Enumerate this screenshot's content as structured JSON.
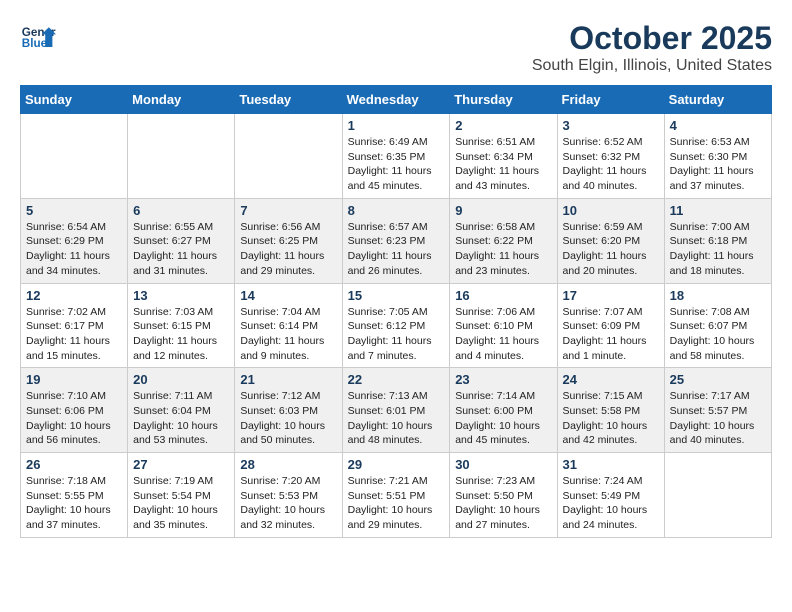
{
  "header": {
    "logo_line1": "General",
    "logo_line2": "Blue",
    "title": "October 2025",
    "subtitle": "South Elgin, Illinois, United States"
  },
  "calendar": {
    "days_of_week": [
      "Sunday",
      "Monday",
      "Tuesday",
      "Wednesday",
      "Thursday",
      "Friday",
      "Saturday"
    ],
    "weeks": [
      [
        {
          "day": "",
          "info": ""
        },
        {
          "day": "",
          "info": ""
        },
        {
          "day": "",
          "info": ""
        },
        {
          "day": "1",
          "info": "Sunrise: 6:49 AM\nSunset: 6:35 PM\nDaylight: 11 hours and 45 minutes."
        },
        {
          "day": "2",
          "info": "Sunrise: 6:51 AM\nSunset: 6:34 PM\nDaylight: 11 hours and 43 minutes."
        },
        {
          "day": "3",
          "info": "Sunrise: 6:52 AM\nSunset: 6:32 PM\nDaylight: 11 hours and 40 minutes."
        },
        {
          "day": "4",
          "info": "Sunrise: 6:53 AM\nSunset: 6:30 PM\nDaylight: 11 hours and 37 minutes."
        }
      ],
      [
        {
          "day": "5",
          "info": "Sunrise: 6:54 AM\nSunset: 6:29 PM\nDaylight: 11 hours and 34 minutes."
        },
        {
          "day": "6",
          "info": "Sunrise: 6:55 AM\nSunset: 6:27 PM\nDaylight: 11 hours and 31 minutes."
        },
        {
          "day": "7",
          "info": "Sunrise: 6:56 AM\nSunset: 6:25 PM\nDaylight: 11 hours and 29 minutes."
        },
        {
          "day": "8",
          "info": "Sunrise: 6:57 AM\nSunset: 6:23 PM\nDaylight: 11 hours and 26 minutes."
        },
        {
          "day": "9",
          "info": "Sunrise: 6:58 AM\nSunset: 6:22 PM\nDaylight: 11 hours and 23 minutes."
        },
        {
          "day": "10",
          "info": "Sunrise: 6:59 AM\nSunset: 6:20 PM\nDaylight: 11 hours and 20 minutes."
        },
        {
          "day": "11",
          "info": "Sunrise: 7:00 AM\nSunset: 6:18 PM\nDaylight: 11 hours and 18 minutes."
        }
      ],
      [
        {
          "day": "12",
          "info": "Sunrise: 7:02 AM\nSunset: 6:17 PM\nDaylight: 11 hours and 15 minutes."
        },
        {
          "day": "13",
          "info": "Sunrise: 7:03 AM\nSunset: 6:15 PM\nDaylight: 11 hours and 12 minutes."
        },
        {
          "day": "14",
          "info": "Sunrise: 7:04 AM\nSunset: 6:14 PM\nDaylight: 11 hours and 9 minutes."
        },
        {
          "day": "15",
          "info": "Sunrise: 7:05 AM\nSunset: 6:12 PM\nDaylight: 11 hours and 7 minutes."
        },
        {
          "day": "16",
          "info": "Sunrise: 7:06 AM\nSunset: 6:10 PM\nDaylight: 11 hours and 4 minutes."
        },
        {
          "day": "17",
          "info": "Sunrise: 7:07 AM\nSunset: 6:09 PM\nDaylight: 11 hours and 1 minute."
        },
        {
          "day": "18",
          "info": "Sunrise: 7:08 AM\nSunset: 6:07 PM\nDaylight: 10 hours and 58 minutes."
        }
      ],
      [
        {
          "day": "19",
          "info": "Sunrise: 7:10 AM\nSunset: 6:06 PM\nDaylight: 10 hours and 56 minutes."
        },
        {
          "day": "20",
          "info": "Sunrise: 7:11 AM\nSunset: 6:04 PM\nDaylight: 10 hours and 53 minutes."
        },
        {
          "day": "21",
          "info": "Sunrise: 7:12 AM\nSunset: 6:03 PM\nDaylight: 10 hours and 50 minutes."
        },
        {
          "day": "22",
          "info": "Sunrise: 7:13 AM\nSunset: 6:01 PM\nDaylight: 10 hours and 48 minutes."
        },
        {
          "day": "23",
          "info": "Sunrise: 7:14 AM\nSunset: 6:00 PM\nDaylight: 10 hours and 45 minutes."
        },
        {
          "day": "24",
          "info": "Sunrise: 7:15 AM\nSunset: 5:58 PM\nDaylight: 10 hours and 42 minutes."
        },
        {
          "day": "25",
          "info": "Sunrise: 7:17 AM\nSunset: 5:57 PM\nDaylight: 10 hours and 40 minutes."
        }
      ],
      [
        {
          "day": "26",
          "info": "Sunrise: 7:18 AM\nSunset: 5:55 PM\nDaylight: 10 hours and 37 minutes."
        },
        {
          "day": "27",
          "info": "Sunrise: 7:19 AM\nSunset: 5:54 PM\nDaylight: 10 hours and 35 minutes."
        },
        {
          "day": "28",
          "info": "Sunrise: 7:20 AM\nSunset: 5:53 PM\nDaylight: 10 hours and 32 minutes."
        },
        {
          "day": "29",
          "info": "Sunrise: 7:21 AM\nSunset: 5:51 PM\nDaylight: 10 hours and 29 minutes."
        },
        {
          "day": "30",
          "info": "Sunrise: 7:23 AM\nSunset: 5:50 PM\nDaylight: 10 hours and 27 minutes."
        },
        {
          "day": "31",
          "info": "Sunrise: 7:24 AM\nSunset: 5:49 PM\nDaylight: 10 hours and 24 minutes."
        },
        {
          "day": "",
          "info": ""
        }
      ]
    ]
  }
}
